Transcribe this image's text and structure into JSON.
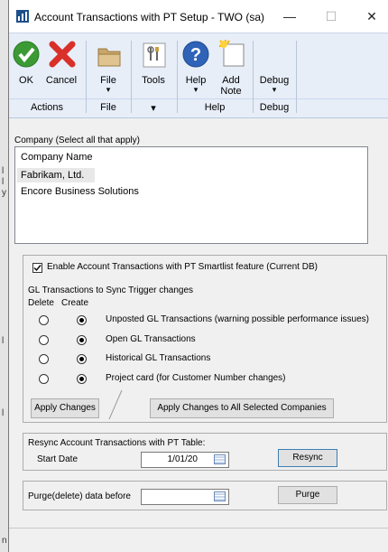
{
  "window": {
    "title": "Account Transactions with PT Setup  -  TWO (sa)",
    "minimize_glyph": "—",
    "maximize_glyph": "☐",
    "close_glyph": "✕"
  },
  "ribbon": {
    "ok": "OK",
    "cancel": "Cancel",
    "file": "File",
    "tools": "Tools",
    "help": "Help",
    "add_note_line1": "Add",
    "add_note_line2": "Note",
    "debug": "Debug",
    "groups": {
      "actions": "Actions",
      "file": "File",
      "tools": "",
      "help": "Help",
      "debug": "Debug"
    },
    "dropdown_glyph": "▾",
    "colors": {
      "ok_green": "#3c9a35",
      "cancel_red": "#d9302a",
      "help_blue": "#2f63b8"
    }
  },
  "company": {
    "section_label": "Company (Select all that apply)",
    "column_header": "Company Name",
    "rows": [
      "Fabrikam, Ltd.",
      "Encore Business Solutions"
    ]
  },
  "sync": {
    "enable_label": "Enable Account Transactions with PT Smartlist feature (Current DB)",
    "enable_checked": true,
    "subtitle": "GL Transactions to Sync Trigger changes",
    "delete_header": "Delete",
    "create_header": "Create",
    "items": [
      {
        "label": "Unposted GL Transactions (warning possible performance issues)",
        "delete": false,
        "create": true
      },
      {
        "label": "Open GL Transactions",
        "delete": false,
        "create": true
      },
      {
        "label": "Historical GL Transactions",
        "delete": false,
        "create": true
      },
      {
        "label": "Project card (for Customer Number changes)",
        "delete": false,
        "create": true
      }
    ],
    "apply_changes": "Apply Changes",
    "apply_all": "Apply Changes to All Selected Companies"
  },
  "resync": {
    "title": "Resync Account Transactions with PT Table:",
    "start_date_label": "Start Date",
    "start_date_value": "1/01/20",
    "button": "Resync"
  },
  "purge": {
    "label": "Purge(delete) data before",
    "date_value": "",
    "button": "Purge"
  },
  "background": {
    "chars": [
      "l",
      "l",
      "y",
      "l",
      "l",
      "n"
    ]
  }
}
